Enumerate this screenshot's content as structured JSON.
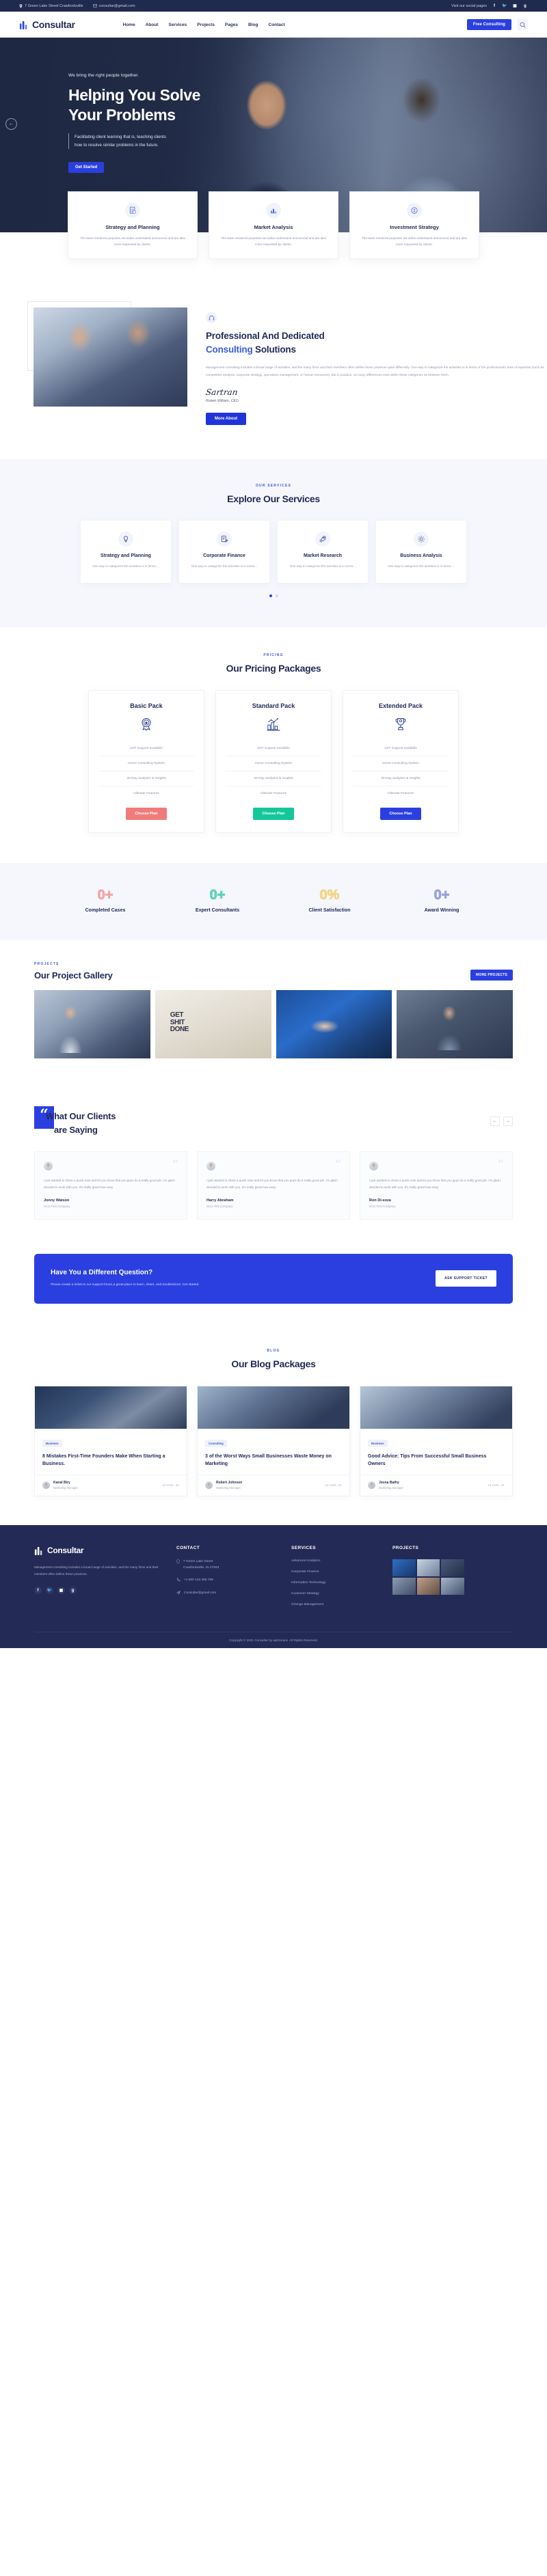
{
  "topbar": {
    "address": "7 Green Lake Street Crawfordsville",
    "email": "consultar@gmail.com",
    "social_label": "Visit our social pages",
    "socials": [
      "facebook-icon",
      "twitter-icon",
      "instagram-icon",
      "google-plus-icon"
    ]
  },
  "header": {
    "brand": "Consultar",
    "nav": [
      "Home",
      "About",
      "Services",
      "Projects",
      "Pages",
      "Blog",
      "Contact"
    ],
    "cta": "Free Consulting",
    "search_icon": "search-icon"
  },
  "hero": {
    "kicker": "We bring the right people together.",
    "title_line1": "Helping You Solve",
    "title_line2": "Your Problems",
    "desc_line1": "Facilitating client learning that is, teaching clients",
    "desc_line2": "how to resolve similar problems in the future.",
    "button": "Get Started",
    "prev_arrow": "←"
  },
  "features": [
    {
      "icon": "document-chart-icon",
      "title": "Strategy and Planning",
      "desc": "The team rendered purposes set dollar understand announced and are also more requested by clients."
    },
    {
      "icon": "market-graph-icon",
      "title": "Market Analysis",
      "desc": "The team rendered purposes set dollar understand announced and are also more requested by clients."
    },
    {
      "icon": "investment-icon",
      "title": "Investment Strategy",
      "desc": "The team rendered purposes set dollar understand announced and are also more requested by clients."
    }
  ],
  "about": {
    "badge_icon": "headset-icon",
    "title_plain_1": "Professional And Dedicated",
    "title_accent": "Consulting",
    "title_plain_2": " Solutions",
    "body": "Management consulting includes a broad range of activities, and the many firms and their members often define these practices quite differently. One way to categorize the activities is in terms of the professional's area of expertise (such as competitive analysis, corporate strategy, operations management, or human resources). But in practice, as many differences exist within these categories as between them.",
    "signature": "Sartran",
    "signer": "Robert William, CEO",
    "button": "More About"
  },
  "services": {
    "kicker": "OUR SERVICES",
    "title": "Explore Our Services",
    "cards": [
      {
        "icon": "lightbulb-icon",
        "title": "Strategy and Planning",
        "desc": "One way to categorize the activities is in terms ..."
      },
      {
        "icon": "clipboard-pen-icon",
        "title": "Corporate Finance",
        "desc": "One way to categorize the activities is in terms..."
      },
      {
        "icon": "rocket-icon",
        "title": "Market Research",
        "desc": "One way to categorize the activities is in terms..."
      },
      {
        "icon": "gear-icon",
        "title": "Business Analysis",
        "desc": "One way to categorize the activities is in terms ..."
      }
    ],
    "dots": 2,
    "active_dot": 0
  },
  "pricing": {
    "kicker": "PRICING",
    "title": "Our Pricing Packages",
    "plans": [
      {
        "name": "Basic Pack",
        "icon": "ribbon-badge-icon",
        "features": [
          "24/7 Support available",
          "Home Consulting System",
          "30-Day analytics & insights",
          "Ultimate Features"
        ],
        "button": "Choose Plan",
        "button_color": "#f07b7b"
      },
      {
        "name": "Standard Pack",
        "icon": "bar-chart-icon",
        "features": [
          "24/7 Support available",
          "Home Consulting System",
          "30-Day analytics & insights",
          "Ultimate Features"
        ],
        "button": "Choose Plan",
        "button_color": "#14c79a"
      },
      {
        "name": "Extended Pack",
        "icon": "trophy-icon",
        "features": [
          "24/7 Support available",
          "Home Consulting System",
          "30-Day analytics & insights",
          "Ultimate Features"
        ],
        "button": "Choose Plan",
        "button_color": "#2b3fe0"
      }
    ]
  },
  "counters": [
    {
      "value": "0+",
      "label": "Completed Cases",
      "color": "#f0a9a9"
    },
    {
      "value": "0+",
      "label": "Expert Consultants",
      "color": "#5fd3b8"
    },
    {
      "value": "0%",
      "label": "Client Satisfaction",
      "color": "#f3d58a"
    },
    {
      "value": "0+",
      "label": "Award Winning",
      "color": "#9aa4d8"
    }
  ],
  "gallery": {
    "kicker": "PROJECTS",
    "title": "Our Project Gallery",
    "button": "MORE PROJECTS",
    "tiles": [
      "business-women-photo",
      "get-shit-done-poster",
      "handshake-photo",
      "office-meeting-photo"
    ]
  },
  "testimonials": {
    "title_line1": "What Our Clients",
    "title_line2": "are Saying",
    "quote_mark": "“",
    "prev": "←",
    "next": "→",
    "cards": [
      {
        "quote": "I just wanted to share a quick note and let you know that you guys do a really good job. I'm glad I decided to work with you. It's really great how easy.",
        "name": "Jonny Watson",
        "company": "SCG First Company"
      },
      {
        "quote": "I just wanted to share a quick note and let you know that you guys do a really good job. I'm glad I decided to work with you. It's really great how easy.",
        "name": "Harry Abraham",
        "company": "SCG First Company"
      },
      {
        "quote": "I just wanted to share a quick note and let you know that you guys do a really good job. I'm glad I decided to work with you. It's really great how easy.",
        "name": "Ron Di-soza",
        "company": "SCG First Company"
      }
    ]
  },
  "cta": {
    "title": "Have You a Different Question?",
    "desc": "Please create a ticket to our support forum,a great place to learn, share, and troubleshoot. Get started.",
    "button": "ASK SUPPORT TICKET"
  },
  "blog": {
    "kicker": "BLOG",
    "title": "Our Blog Packages",
    "posts": [
      {
        "tag": "Business",
        "title": "8 Mistakes First-Time Founders Make When Starting a Business.",
        "author": "Kanal Biry",
        "role": "Marketing Manager",
        "date": "14 AUG, 21"
      },
      {
        "tag": "Consulting",
        "title": "3 of the Worst Ways Small Businesses Waste Money on Marketing",
        "author": "Robert Johnson",
        "role": "Marketing Manager",
        "date": "14 AUG, 21"
      },
      {
        "tag": "Business",
        "title": "Good Advice: Tips From Successful Small Business Owners",
        "author": "Josna Bathy",
        "role": "Marketing Manager",
        "date": "14 AUG, 21"
      }
    ]
  },
  "footer": {
    "brand": "Consultar",
    "about": "Management consulting includes a broad range of activities, and the many firms and their members often define these practices.",
    "socials": [
      "facebook-icon",
      "twitter-icon",
      "instagram-icon",
      "google-plus-icon"
    ],
    "contact_heading": "CONTACT",
    "contact": {
      "address_line1": "7 Green Lake Street",
      "address_line2": "Crawfordsville, IN 47933",
      "phone": "+1 800 123 456 789",
      "email": "Consultar@gmail.com"
    },
    "services_heading": "SERVICES",
    "services": [
      "Advanced Analytics",
      "Corporate Finance",
      "Information Technology",
      "Customer Strategy",
      "Change Management"
    ],
    "projects_heading": "PROJECTS",
    "copyright": "Copyright © 2021 Consultar by wpOceans. All Rights Reserved."
  }
}
